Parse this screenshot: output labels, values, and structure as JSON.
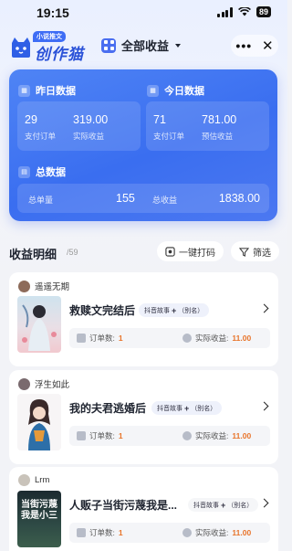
{
  "status_bar": {
    "time": "19:15",
    "battery": "89"
  },
  "header": {
    "logo_badge": "小说推文",
    "logo_text": "创作猫",
    "scope_label": "全部收益",
    "more_icon": "more-dots-icon",
    "close_icon": "close-icon"
  },
  "stats": {
    "yesterday": {
      "title": "昨日数据",
      "orders": "29",
      "orders_label": "支付订单",
      "income": "319.00",
      "income_label": "实际收益"
    },
    "today": {
      "title": "今日数据",
      "orders": "71",
      "orders_label": "支付订单",
      "income": "781.00",
      "income_label": "预估收益"
    },
    "total": {
      "title": "总数据",
      "count_label": "总单量",
      "count": "155",
      "income_label": "总收益",
      "income": "1838.00"
    }
  },
  "list": {
    "title": "收益明细",
    "count": "/59",
    "code_button": "一键打码",
    "filter_button": "筛选"
  },
  "items": [
    {
      "author": "遥遥无期",
      "title": "救赎文完结后",
      "tag": "抖音故事",
      "tag_suffix": "（别名）",
      "orders_label": "订单数:",
      "orders": "1",
      "income_label": "实际收益:",
      "income": "11.00"
    },
    {
      "author": "浮生如此",
      "title": "我的夫君逃婚后",
      "tag": "抖音故事",
      "tag_suffix": "（别名）",
      "orders_label": "订单数:",
      "orders": "1",
      "income_label": "实际收益:",
      "income": "11.00"
    },
    {
      "author": "Lrm",
      "title": "人贩子当街污蔑我是...",
      "tag": "抖音故事",
      "tag_suffix": "（别名）",
      "orders_label": "订单数:",
      "orders": "1",
      "income_label": "实际收益:",
      "income": "11.00",
      "cover_text": "当街污蔑我是小三"
    }
  ],
  "colors": {
    "accent": "#3a6ef0",
    "income": "#e8742a"
  }
}
